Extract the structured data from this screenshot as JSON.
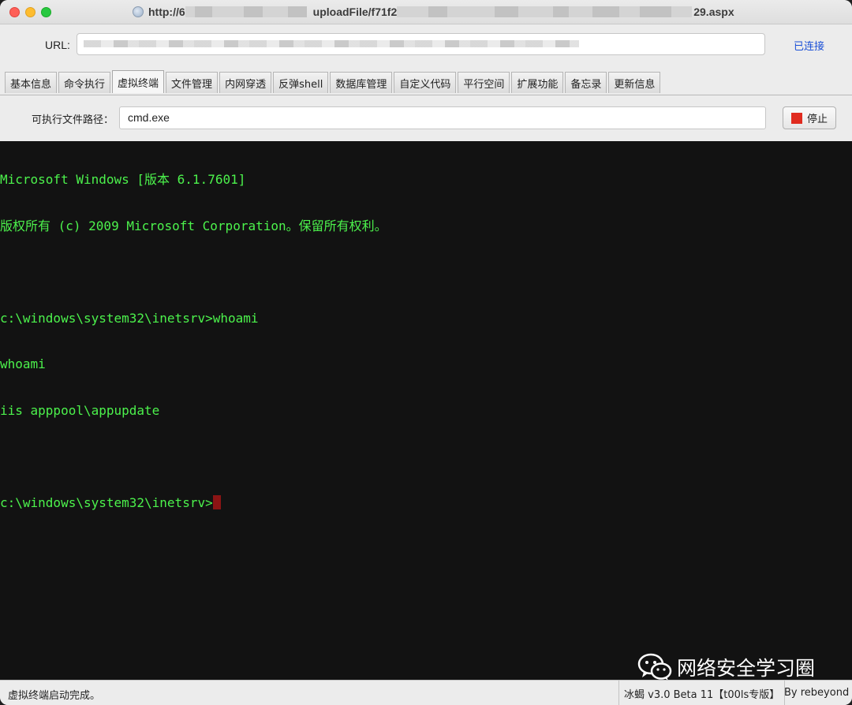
{
  "window": {
    "title_prefix": "http://6",
    "title_middle": "uploadFile/f71f2",
    "title_suffix": "29.aspx"
  },
  "url_bar": {
    "label": "URL:",
    "status": "已连接"
  },
  "tabs": [
    {
      "label": "基本信息"
    },
    {
      "label": "命令执行"
    },
    {
      "label": "虚拟终端",
      "active": true
    },
    {
      "label": "文件管理"
    },
    {
      "label": "内网穿透"
    },
    {
      "label": "反弹shell"
    },
    {
      "label": "数据库管理"
    },
    {
      "label": "自定义代码"
    },
    {
      "label": "平行空间"
    },
    {
      "label": "扩展功能"
    },
    {
      "label": "备忘录"
    },
    {
      "label": "更新信息"
    }
  ],
  "path": {
    "label": "可执行文件路径：",
    "value": "cmd.exe",
    "stop_label": "停止",
    "stop_color": "#e02b1f"
  },
  "terminal": {
    "text_color": "#4cf24c",
    "lines": [
      "Microsoft Windows [版本 6.1.7601]",
      "版权所有 (c) 2009 Microsoft Corporation。保留所有权利。",
      "",
      "c:\\windows\\system32\\inetsrv>whoami",
      "whoami",
      "iis apppool\\appupdate",
      "",
      "c:\\windows\\system32\\inetsrv>"
    ]
  },
  "watermark": {
    "text": "网络安全学习圈",
    "icon": "wechat-icon"
  },
  "statusbar": {
    "message": "虚拟终端启动完成。",
    "version": "冰蝎 v3.0 Beta 11【t00ls专版】",
    "author": "By rebeyond"
  }
}
